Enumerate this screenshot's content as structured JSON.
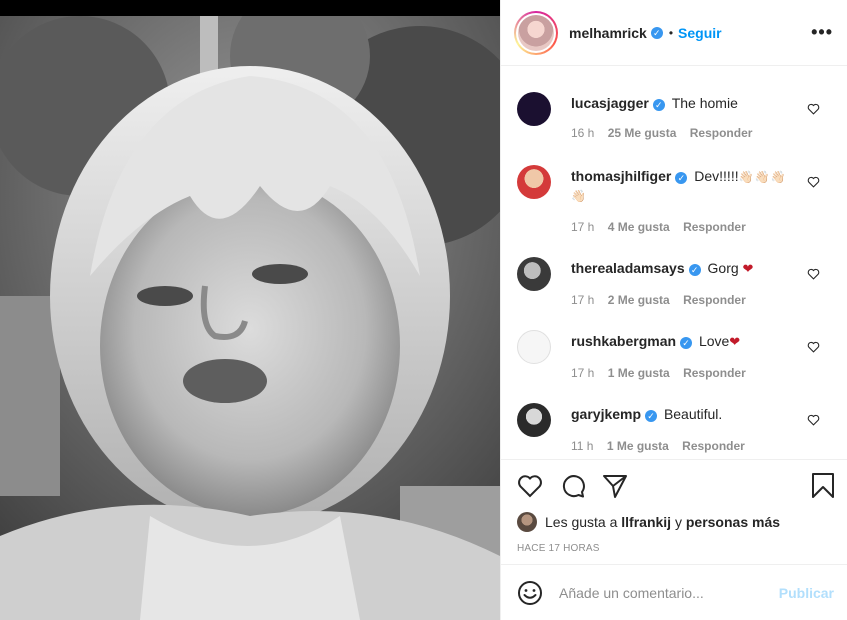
{
  "post": {
    "author": "melhamrick",
    "follow_label": "Seguir",
    "separator": "•",
    "more_label": "•••"
  },
  "comments": [
    {
      "user": "lucasjagger",
      "text": "The homie",
      "time": "16 h",
      "likes": "25 Me gusta",
      "reply": "Responder",
      "avatar_color": "#1b1030"
    },
    {
      "user": "thomasjhilfiger",
      "text": "Dev!!!!!",
      "emoji": "👋🏻👋🏻👋🏻👋🏻",
      "time": "17 h",
      "likes": "4 Me gusta",
      "reply": "Responder",
      "avatar_color": "#d43a3a"
    },
    {
      "user": "therealadamsays",
      "text": "Gorg",
      "heart": "❤",
      "time": "17 h",
      "likes": "2 Me gusta",
      "reply": "Responder",
      "avatar_color": "#3a3a3a"
    },
    {
      "user": "rushkabergman",
      "text": "Love",
      "heart": "❤",
      "time": "17 h",
      "likes": "1 Me gusta",
      "reply": "Responder",
      "avatar_color": "#f2f2f2"
    },
    {
      "user": "garyjkemp",
      "text": "Beautiful.",
      "time": "11 h",
      "likes": "1 Me gusta",
      "reply": "Responder",
      "avatar_color": "#2b2b2b"
    }
  ],
  "likes_summary": {
    "prefix": "Les gusta a",
    "user": "llfrankij",
    "middle": "y",
    "suffix": "personas más"
  },
  "time_ago": "HACE 17 HORAS",
  "add_comment": {
    "placeholder": "Añade un comentario...",
    "post_label": "Publicar"
  },
  "icons": [
    "heart-icon",
    "comment-icon",
    "share-icon",
    "bookmark-icon",
    "emoji-icon",
    "verified-icon"
  ]
}
